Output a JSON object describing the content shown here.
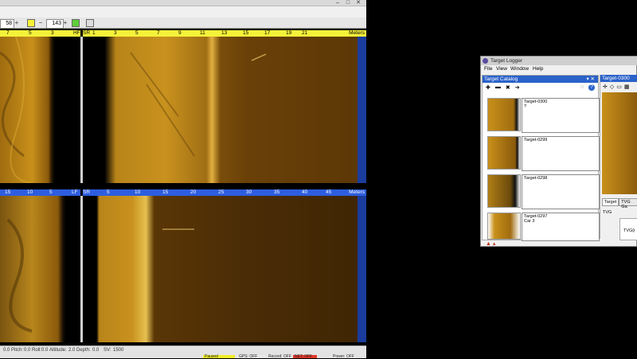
{
  "toolbar": {
    "field_a": "58",
    "field_b": "143",
    "plus": "+",
    "minus": "−"
  },
  "top_port_ruler": {
    "ticks": [
      "7",
      "5",
      "3",
      "HF"
    ]
  },
  "top_stbd_ruler": {
    "side": "SR",
    "ticks": [
      "1",
      "3",
      "5",
      "7",
      "9",
      "11",
      "13",
      "15",
      "17",
      "19",
      "21"
    ],
    "unit": "Meters"
  },
  "bottom_port_ruler": {
    "ticks": [
      "15",
      "10",
      "5",
      "LF"
    ]
  },
  "bottom_stbd_ruler": {
    "side": "SR",
    "ticks": [
      "5",
      "10",
      "15",
      "20",
      "25",
      "30",
      "35",
      "40",
      "45"
    ],
    "unit": "Meters"
  },
  "status_bar": {
    "items": [
      "0.0",
      "Pitch:",
      "0.0",
      "Roll:",
      "0.0",
      "Altitude:",
      "2.0",
      "Depth:",
      "0.0",
      "SV:",
      "1500"
    ],
    "lamps": [
      "Paused",
      "GPS: OFF",
      "Record: OFF",
      "NET: OFF",
      "Power: OFF"
    ]
  },
  "target_logger": {
    "title": "Target Logger",
    "menu": [
      "File",
      "View",
      "Window",
      "Help"
    ],
    "catalog_title": "Target Catalog",
    "detail_title": "Target-0300",
    "targets": [
      {
        "name": "Target-0300",
        "note": "?"
      },
      {
        "name": "Target-0299",
        "note": ""
      },
      {
        "name": "Target-0298",
        "note": ""
      },
      {
        "name": "Target-0297",
        "note": "Car 3"
      }
    ],
    "tabs": [
      "Target",
      "TVG Ga"
    ],
    "tvg_label": "TVG",
    "tvg_field": "TVG(i"
  },
  "colors": {
    "ruler_yellow": "#f5f23a",
    "ruler_blue": "#2d5ee0",
    "panel_blue": "#2a62c9",
    "sonar_gold": "#c8901a",
    "lamp_paused": "#f0ee2a",
    "lamp_net": "#e23a2a"
  }
}
